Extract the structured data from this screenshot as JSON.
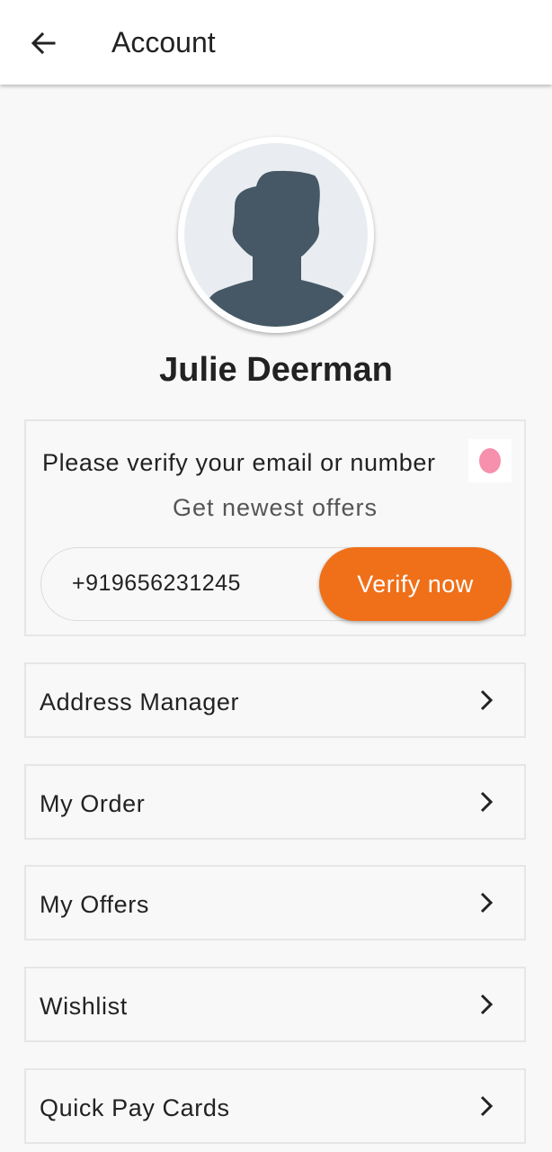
{
  "header": {
    "title": "Account",
    "back_icon": "arrow-left-icon"
  },
  "profile": {
    "name": "Julie Deerman",
    "avatar_icon": "default-avatar-icon"
  },
  "verify": {
    "title": "Please verify your email or number",
    "subtitle": "Get newest offers",
    "phone_value": "+919656231245",
    "button_label": "Verify now",
    "button_color": "#ef7019",
    "dot_color": "#f690ac"
  },
  "menu": {
    "items": [
      {
        "label": "Address Manager"
      },
      {
        "label": "My Order"
      },
      {
        "label": "My Offers"
      },
      {
        "label": "Wishlist"
      },
      {
        "label": "Quick Pay Cards"
      }
    ]
  }
}
